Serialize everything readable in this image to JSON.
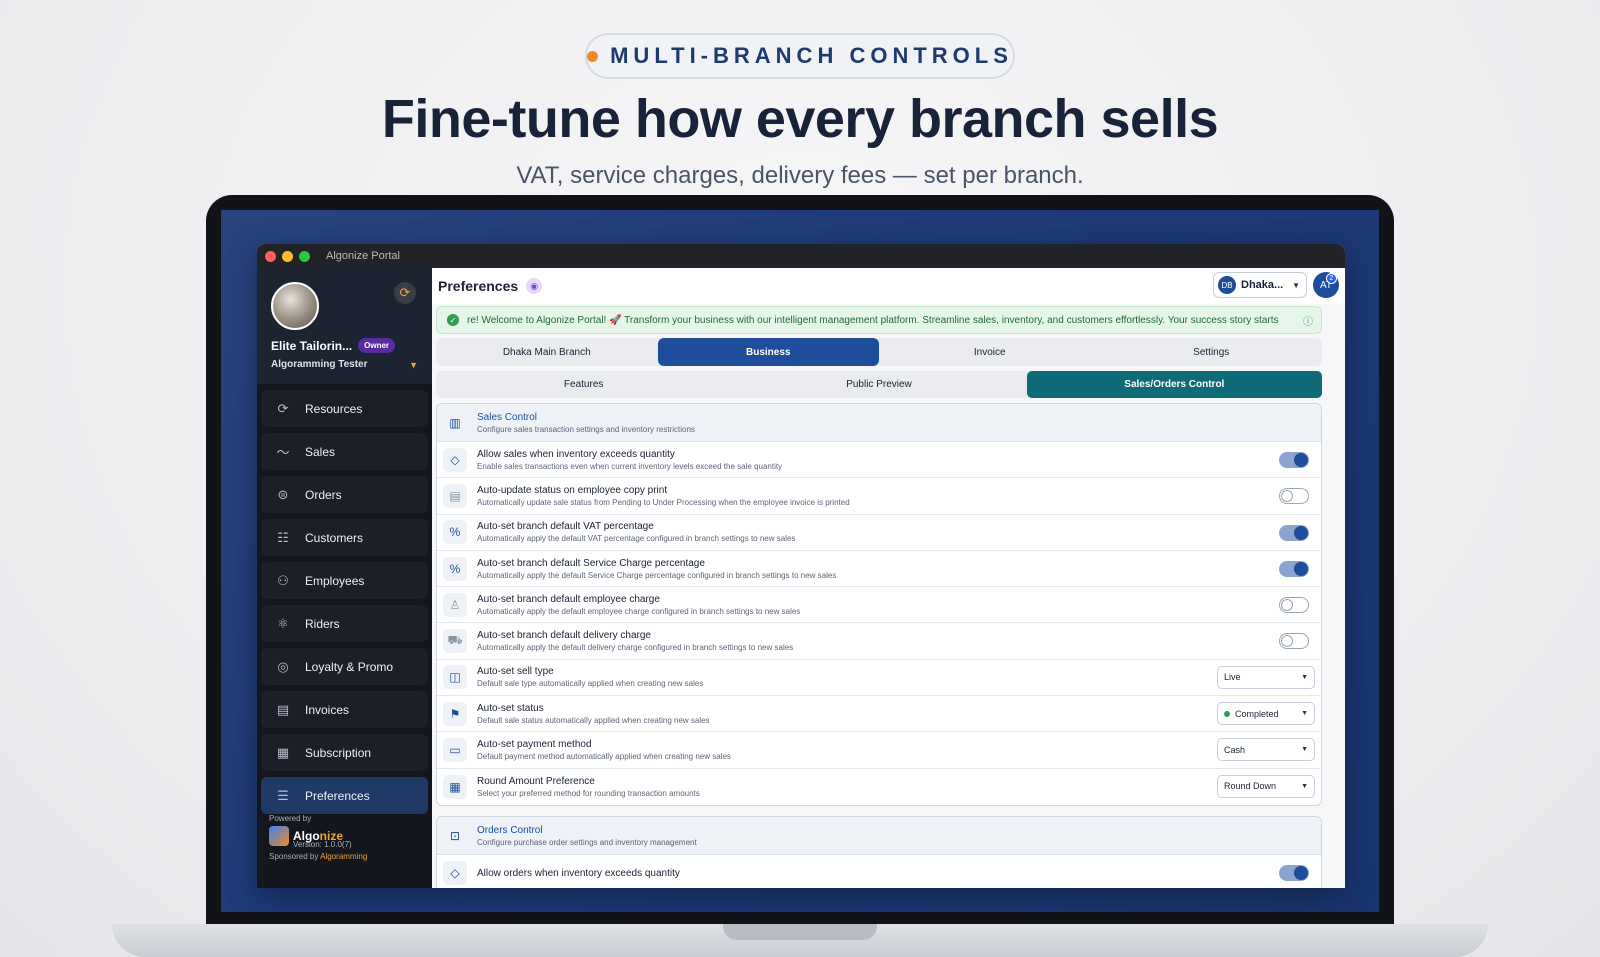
{
  "hero": {
    "pill_text": "MULTI-BRANCH CONTROLS",
    "title": "Fine-tune how every branch sells",
    "subtitle": "VAT, service charges, delivery fees — set per branch."
  },
  "window": {
    "title": "Algonize Portal"
  },
  "profile": {
    "org_name": "Elite Tailorin...",
    "role_badge": "Owner",
    "user_name": "Algoramming Tester"
  },
  "sidebar": {
    "items": [
      {
        "label": "Resources",
        "icon": "refresh-icon"
      },
      {
        "label": "Sales",
        "icon": "trend-icon"
      },
      {
        "label": "Orders",
        "icon": "orders-icon"
      },
      {
        "label": "Customers",
        "icon": "customers-icon"
      },
      {
        "label": "Employees",
        "icon": "employees-icon"
      },
      {
        "label": "Riders",
        "icon": "riders-icon"
      },
      {
        "label": "Loyalty & Promo",
        "icon": "medal-icon"
      },
      {
        "label": "Invoices",
        "icon": "invoice-icon"
      },
      {
        "label": "Subscription",
        "icon": "subscription-icon"
      },
      {
        "label": "Preferences",
        "icon": "sliders-icon",
        "active": true
      }
    ],
    "powered_by": "Powered by",
    "brand_a": "Algo",
    "brand_b": "nize",
    "version": "Version: 1.0.0(7)",
    "sponsored_prefix": "Sponsored by ",
    "sponsor": "Algoramming"
  },
  "topbar": {
    "title": "Preferences",
    "branch_initials": "DB",
    "branch_label": "Dhaka...",
    "user_initials": "AT",
    "notification_count": "2"
  },
  "banner": {
    "text": "re! Welcome to Algonize Portal! 🚀 Transform your business with our intelligent management platform. Streamline sales, inventory, and customers effortlessly. Your success story starts"
  },
  "tabs_primary": [
    "Dhaka Main Branch",
    "Business",
    "Invoice",
    "Settings"
  ],
  "tabs_primary_active": "Business",
  "tabs_secondary": [
    "Features",
    "Public Preview",
    "Sales/Orders Control"
  ],
  "tabs_secondary_active": "Sales/Orders Control",
  "sales_control": {
    "title": "Sales Control",
    "description": "Configure sales transaction settings and inventory restrictions",
    "rows": [
      {
        "title": "Allow sales when inventory exceeds quantity",
        "desc": "Enable sales transactions even when current inventory levels exceed the sale quantity",
        "control": "toggle",
        "on": true,
        "icon": "tag-icon"
      },
      {
        "title": "Auto-update status on employee copy print",
        "desc": "Automatically update sale status from Pending to Under Processing when the employee invoice is printed",
        "control": "toggle",
        "on": false,
        "icon": "print-icon"
      },
      {
        "title": "Auto-set branch default VAT percentage",
        "desc": "Automatically apply the default VAT percentage configured in branch settings to new sales",
        "control": "toggle",
        "on": true,
        "icon": "percent-icon"
      },
      {
        "title": "Auto-set branch default Service Charge percentage",
        "desc": "Automatically apply the default Service Charge percentage configured in branch settings to new sales",
        "control": "toggle",
        "on": true,
        "icon": "percent-icon"
      },
      {
        "title": "Auto-set branch default employee charge",
        "desc": "Automatically apply the default employee charge configured in branch settings to new sales",
        "control": "toggle",
        "on": false,
        "icon": "user-icon"
      },
      {
        "title": "Auto-set branch default delivery charge",
        "desc": "Automatically apply the default delivery charge configured in branch settings to new sales",
        "control": "toggle",
        "on": false,
        "icon": "truck-icon"
      },
      {
        "title": "Auto-set sell type",
        "desc": "Default sale type automatically applied when creating new sales",
        "control": "select",
        "value": "Live",
        "icon": "bag-icon"
      },
      {
        "title": "Auto-set status",
        "desc": "Default sale status automatically applied when creating new sales",
        "control": "select",
        "value": "Completed",
        "status_dot": true,
        "icon": "flag-icon"
      },
      {
        "title": "Auto-set payment method",
        "desc": "Default payment method automatically applied when creating new sales",
        "control": "select",
        "value": "Cash",
        "icon": "card-icon"
      },
      {
        "title": "Round Amount Preference",
        "desc": "Select your preferred method for rounding transaction amounts",
        "control": "select",
        "value": "Round Down",
        "icon": "calculator-icon"
      }
    ]
  },
  "orders_control": {
    "title": "Orders Control",
    "description": "Configure purchase order settings and inventory management",
    "rows": [
      {
        "title": "Allow orders when inventory exceeds quantity",
        "control": "toggle",
        "on": true,
        "icon": "tag-icon"
      }
    ]
  },
  "colors": {
    "accent": "#1e4d9b",
    "teal": "#0f6b78",
    "orange": "#f08a24",
    "success": "#2f9e4f"
  }
}
